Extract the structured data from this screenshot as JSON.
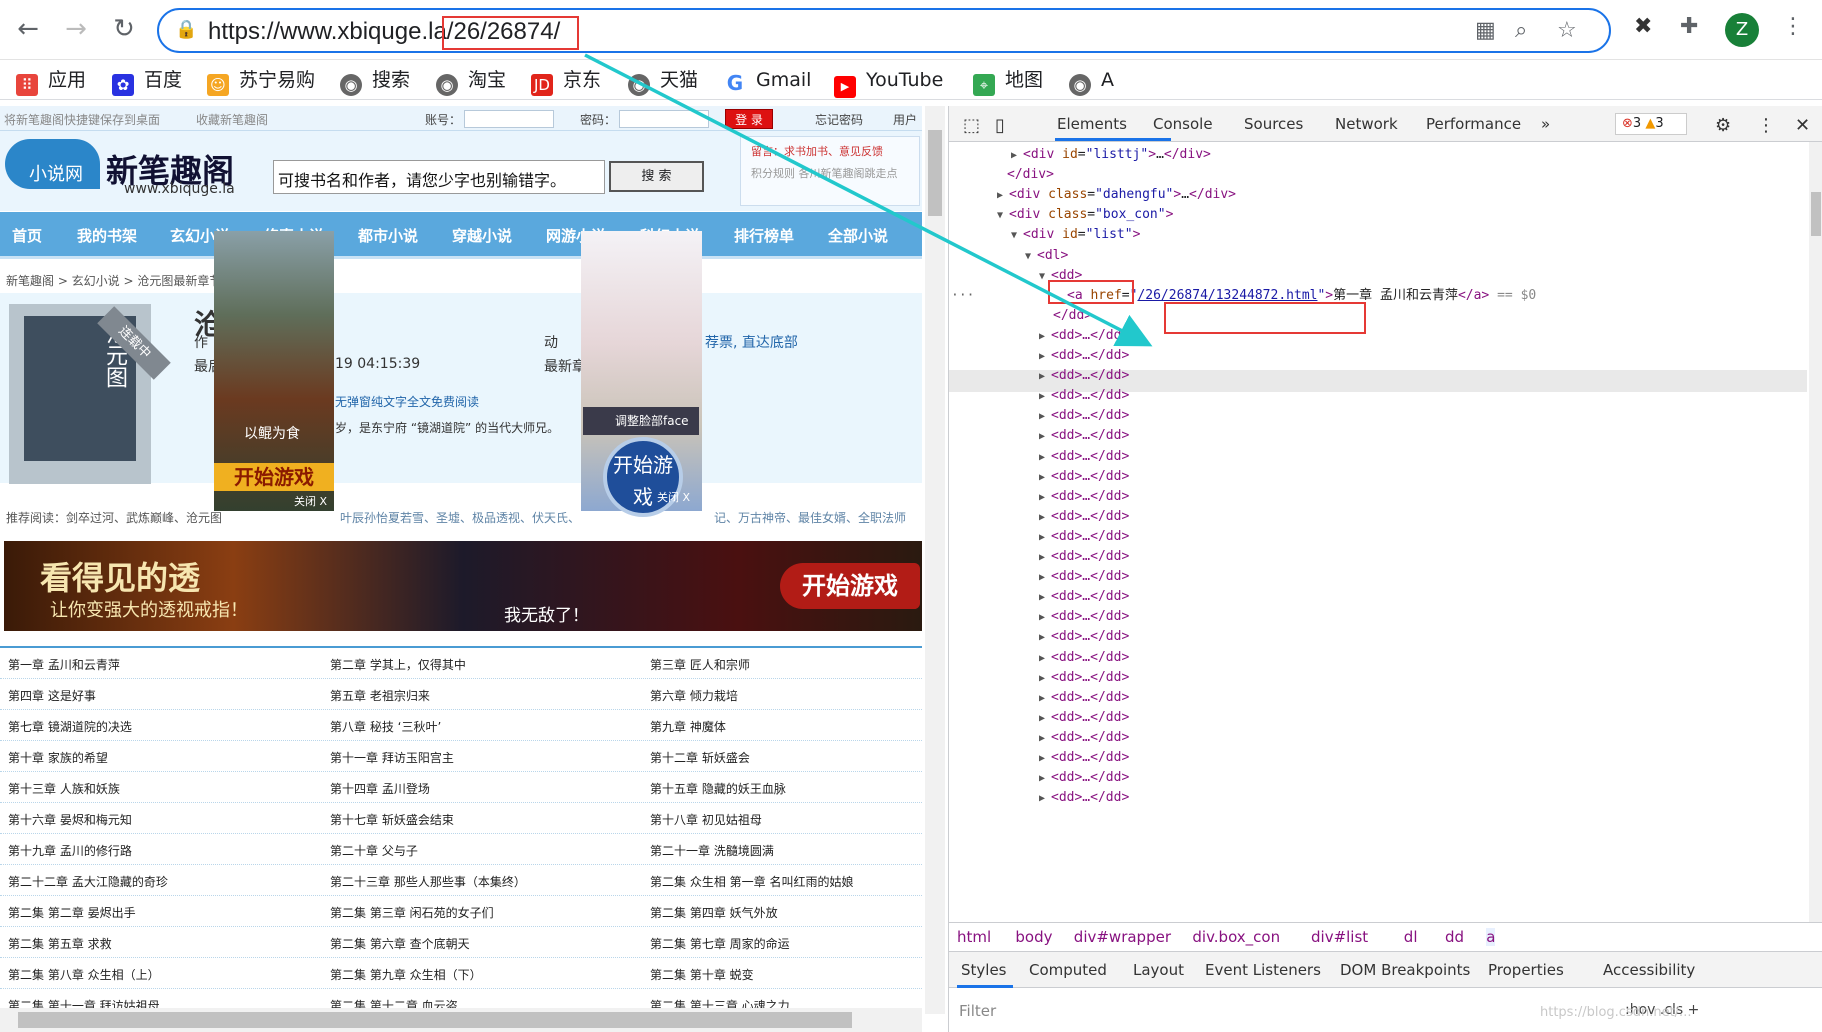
{
  "browser": {
    "url_host": "https://www.xbiquge.la/",
    "url_path": "26/26874/",
    "avatar": "Z",
    "icons": {
      "back": "arrow-left-icon",
      "forward": "arrow-right-icon",
      "reload": "reload-icon",
      "lock": "lock-icon",
      "zoom": "magnify-icon",
      "star": "star-icon",
      "ext": "puzzle-icon",
      "menu": "kebab-icon"
    }
  },
  "bookmarks": [
    "应用",
    "百度",
    "苏宁易购",
    "搜索",
    "淘宝",
    "京东",
    "天猫",
    "Gmail",
    "YouTube",
    "地图",
    "A"
  ],
  "site": {
    "topbar": {
      "left1": "将新笔趣阁快捷键保存到桌面",
      "left2": "收藏新笔趣阁",
      "account_label": "账号：",
      "password_label": "密码：",
      "login": "登 录",
      "forgot": "忘记密码",
      "user": "用户"
    },
    "logo_main": "新笔趣阁",
    "logo_small": "小说网",
    "logo_domain": "www.xbiquge.la",
    "search_placeholder": "可搜书名和作者，请您少字也别输错字。",
    "search_button": "搜 索",
    "header_note1": "留言：求书加书、意见反馈",
    "header_note2": "积分规则  各川新笔趣阁跳走点",
    "nav": [
      "首页",
      "我的书架",
      "玄幻小说",
      "修真小说",
      "都市小说",
      "穿越小说",
      "网游小说",
      "科幻小说",
      "排行榜单",
      "全部小说"
    ],
    "crumb": "新笔趣阁 > 玄幻小说 > 沧元图最新章节",
    "book": {
      "cover_title": "沧元图",
      "ribbon": "连载中",
      "title_char": "沧",
      "author_label": "作",
      "action_label": "动",
      "links": "荐票, 直达底部",
      "update_prefix": "最后",
      "update_time": "19 04:15:39",
      "latest_label": "最新章",
      "intro1": "无弹窗纯文字全文免费阅读",
      "intro2": "岁，是东宁府 “镜湖道院” 的当代大师兄。"
    },
    "recommend_label": "推荐阅读：剑卒过河、武炼巅峰、沧元图",
    "recommend2": "叶辰孙怡夏若雪、圣墟、极品透视、伏天氏、",
    "recommend3": "记、万古神帝、最佳女婿、全职法师",
    "banner": {
      "t1": "看得见的透",
      "t2": "让你变强大的透视戒指！",
      "t3": "我无敌了！",
      "start": "开始游戏"
    },
    "ad1": {
      "caption": "以鲲为食",
      "start": "开始游戏",
      "close": "关闭 X"
    },
    "ad2": {
      "face": "调整脸部face",
      "start": "开始游戏",
      "close": "关闭 X"
    },
    "chapters": [
      [
        "第一章 孟川和云青萍",
        "第二章 学其上，仅得其中",
        "第三章 匠人和宗师"
      ],
      [
        "第四章 这是好事",
        "第五章 老祖宗归来",
        "第六章 倾力栽培"
      ],
      [
        "第七章 镜湖道院的决选",
        "第八章 秘技 ‘三秋叶’",
        "第九章 神魔体"
      ],
      [
        "第十章 家族的希望",
        "第十一章 拜访玉阳宫主",
        "第十二章 斩妖盛会"
      ],
      [
        "第十三章 人族和妖族",
        "第十四章 孟川登场",
        "第十五章 隐藏的妖王血脉"
      ],
      [
        "第十六章 晏烬和梅元知",
        "第十七章 斩妖盛会结束",
        "第十八章 初见姑祖母"
      ],
      [
        "第十九章 孟川的修行路",
        "第二十章 父与子",
        "第二十一章 洗髓境圆满"
      ],
      [
        "第二十二章 孟大江隐藏的奇珍",
        "第二十三章 那些人那些事（本集终）",
        "第二集 众生相 第一章 名叫红雨的姑娘"
      ],
      [
        "第二集 第二章 晏烬出手",
        "第二集 第三章 闲石苑的女子们",
        "第二集 第四章 妖气外放"
      ],
      [
        "第二集 第五章 求救",
        "第二集 第六章 查个底朝天",
        "第二集 第七章 周家的命运"
      ],
      [
        "第二集 第八章 众生相（上）",
        "第二集 第九章 众生相（下）",
        "第二集 第十章 蜕变"
      ],
      [
        "第二集 第十一章 拜访姑祖母",
        "第二集 第十二章 血云盗",
        "第二集 第十三章 心魂之力"
      ]
    ]
  },
  "devtools": {
    "tabs": [
      "Elements",
      "Console",
      "Sources",
      "Network",
      "Performance"
    ],
    "errors": "3",
    "warnings": "3",
    "tree": [
      {
        "ind": 62,
        "tri": "▶",
        "html": "<span class='tg'>&lt;div</span> <span class='an'>id</span>=<span class='av'>\"listtj\"</span><span class='tg'>&gt;</span>…<span class='tg'>&lt;/div&gt;</span>"
      },
      {
        "ind": 58,
        "tri": "",
        "html": "<span class='tg'>&lt;/div&gt;</span>"
      },
      {
        "ind": 48,
        "tri": "▶",
        "html": "<span class='tg'>&lt;div</span> <span class='an'>class</span>=<span class='av'>\"dahengfu\"</span><span class='tg'>&gt;</span>…<span class='tg'>&lt;/div&gt;</span>"
      },
      {
        "ind": 48,
        "tri": "▼",
        "html": "<span class='tg'>&lt;div</span> <span class='an'>class</span>=<span class='av'>\"box_con\"</span><span class='tg'>&gt;</span>"
      },
      {
        "ind": 62,
        "tri": "▼",
        "html": "<span class='tg'>&lt;div</span> <span class='an'>id</span>=<span class='av'>\"list\"</span><span class='tg'>&gt;</span>"
      },
      {
        "ind": 76,
        "tri": "▼",
        "html": "<span class='tg'>&lt;dl&gt;</span>"
      },
      {
        "ind": 90,
        "tri": "▼",
        "html": "<span class='tg'>&lt;dd&gt;</span>"
      },
      {
        "ind": 118,
        "tri": "",
        "html": "<span class='tg'>&lt;a</span> <span class='an'>href</span>=<span class='av'>\"<u>/26/26874/13244872.html</u>\"</span><span class='tg'>&gt;</span><span class='tx'>第一章 孟川和云青萍</span><span class='tg'>&lt;/a&gt;</span> <span style='color:#888'>== $0</span>"
      },
      {
        "ind": 104,
        "tri": "",
        "html": "<span class='tg'>&lt;/dd&gt;</span>"
      }
    ],
    "dd_collapsed": "<dd>…</dd>",
    "dd_count": 24,
    "crumbs": [
      "html",
      "body",
      "div#wrapper",
      "div.box_con",
      "div#list",
      "dl",
      "dd",
      "a"
    ],
    "subtabs": [
      "Styles",
      "Computed",
      "Layout",
      "Event Listeners",
      "DOM Breakpoints",
      "Properties",
      "Accessibility"
    ],
    "filter_placeholder": "Filter",
    "filter_right": ":hov  .cls  +"
  },
  "watermark": "https://blog.csdn.net/..."
}
